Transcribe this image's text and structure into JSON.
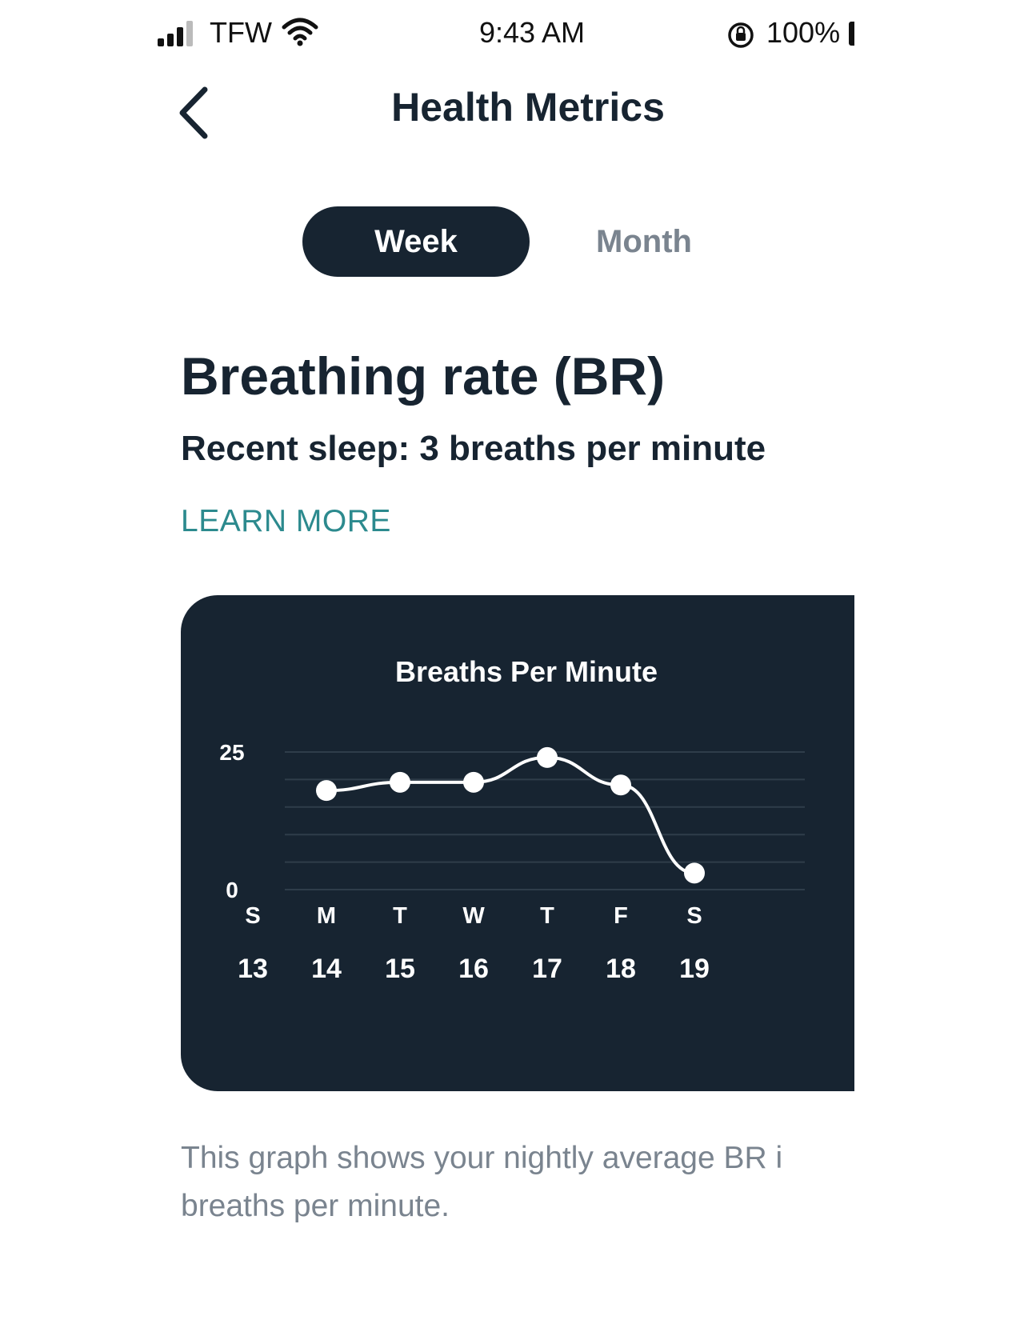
{
  "status_bar": {
    "carrier": "TFW",
    "time": "9:43 AM",
    "battery_percent": "100%",
    "signal_bars": 3
  },
  "header": {
    "title": "Health Metrics",
    "back_icon": "chevron-left-icon"
  },
  "segments": {
    "week_label": "Week",
    "month_label": "Month",
    "selected": "Week"
  },
  "metric": {
    "title": "Breathing rate (BR)",
    "subtitle": "Recent sleep: 3 breaths per minute",
    "learn_more": "LEARN MORE"
  },
  "footnote": "This graph shows your nightly average BR i breaths per minute.",
  "colors": {
    "dark": "#172431",
    "accent": "#2c8a8e",
    "muted": "#7a848f"
  },
  "chart_data": {
    "type": "line",
    "title": "Breaths Per Minute",
    "ylim": [
      0,
      25
    ],
    "yticks": [
      "25",
      "0"
    ],
    "grid": true,
    "days": [
      "S",
      "M",
      "T",
      "W",
      "T",
      "F",
      "S"
    ],
    "dates": [
      "13",
      "14",
      "15",
      "16",
      "17",
      "18",
      "19"
    ],
    "series": [
      {
        "values": [
          null,
          18,
          19.5,
          19.5,
          24,
          19,
          3
        ]
      }
    ]
  }
}
